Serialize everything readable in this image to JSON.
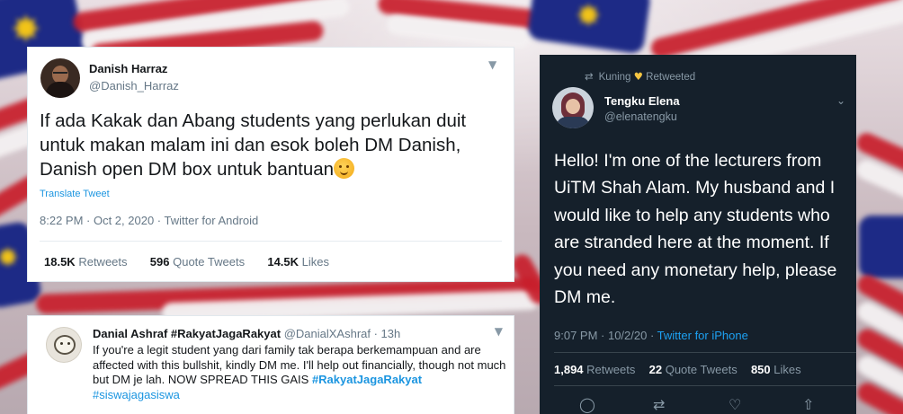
{
  "background": {
    "description_colors": {
      "flag_red": "#c81e2b",
      "flag_white": "#f4f1f2",
      "flag_blue": "#1d2a86",
      "flag_yellow": "#f2c418"
    }
  },
  "tweet_danish": {
    "name": "Danish Harraz",
    "handle": "@Danish_Harraz",
    "text": "If ada Kakak dan Abang students yang perlukan duit untuk makan malam ini dan esok boleh DM Danish, Danish open DM box untuk bantuan",
    "emoji": "hugging-face-emoji",
    "translate_label": "Translate Tweet",
    "timestamp": "8:22 PM · Oct 2, 2020 · Twitter for Android",
    "stats": {
      "retweets_count": "18.5K",
      "retweets_label": "Retweets",
      "quotes_count": "596",
      "quotes_label": "Quote Tweets",
      "likes_count": "14.5K",
      "likes_label": "Likes"
    },
    "menu_icon": "chevron-down-icon"
  },
  "tweet_danial": {
    "name": "Danial Ashraf #RakyatJagaRakyat",
    "handle_time": "@DanialXAshraf · 13h",
    "text_plain": "If you're a legit student yang dari family tak berapa berkemampuan and are affected with this bullshit, kindly DM me. I'll help out financially, though not much but DM je lah. NOW SPREAD THIS GAIS ",
    "hashtag_1": "#RakyatJagaRakyat",
    "hashtag_2": "#siswajagasiswa",
    "menu_icon": "chevron-down-icon"
  },
  "tweet_elena": {
    "retweeted_by_name": "Kuning",
    "retweeted_label": "Retweeted",
    "retweet_icon": "retweet-icon",
    "heart_emoji": "♥",
    "name": "Tengku Elena",
    "handle": "@elenatengku",
    "text": "Hello! I'm one of the lecturers from UiTM Shah Alam. My husband and I would like to help any students who are stranded here at the moment. If you need any monetary help, please DM me.",
    "time_date": "9:07 PM · 10/2/20 · ",
    "source": "Twitter for iPhone",
    "stats": {
      "retweets_count": "1,894",
      "retweets_label": "Retweets",
      "quotes_count": "22",
      "quotes_label": "Quote Tweets",
      "likes_count": "850",
      "likes_label": "Likes"
    },
    "actions": [
      "reply-icon",
      "retweet-icon",
      "like-icon",
      "share-icon"
    ],
    "theme": {
      "bg": "#15202b",
      "accent": "#1da1f2"
    }
  }
}
